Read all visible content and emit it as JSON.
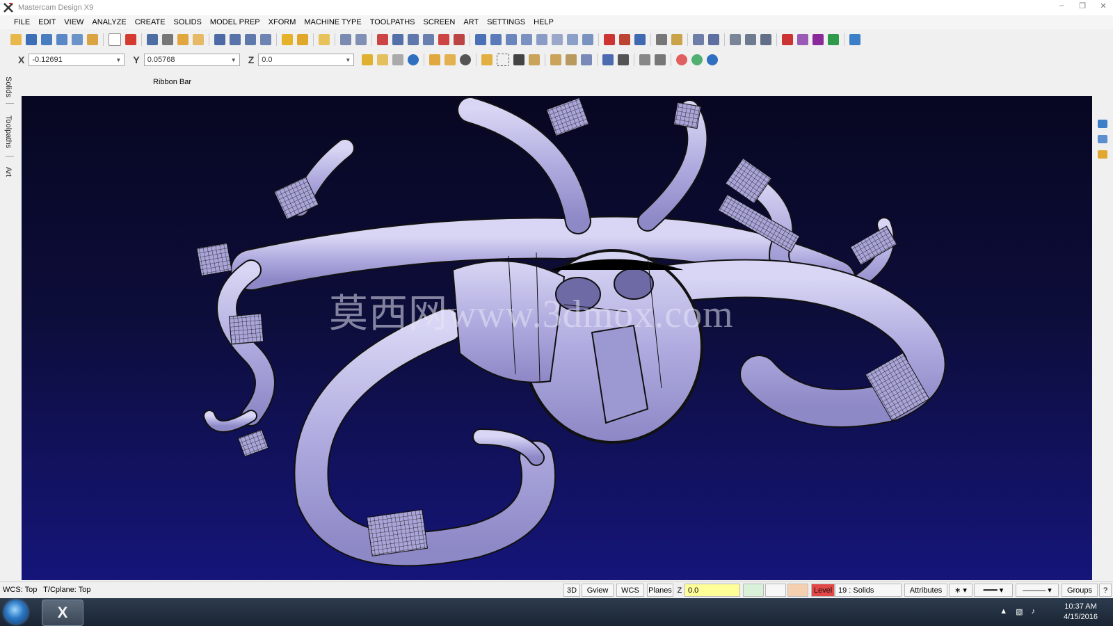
{
  "window": {
    "title": "Mastercam Design X9"
  },
  "menu": [
    "FILE",
    "EDIT",
    "VIEW",
    "ANALYZE",
    "CREATE",
    "SOLIDS",
    "MODEL PREP",
    "XFORM",
    "MACHINE TYPE",
    "TOOLPATHS",
    "SCREEN",
    "ART",
    "SETTINGS",
    "HELP"
  ],
  "coords": {
    "x_label": "X",
    "x_value": "-0.12691",
    "y_label": "Y",
    "y_value": "0.05768",
    "z_label": "Z",
    "z_value": "0.0"
  },
  "ribbon_label": "Ribbon Bar",
  "left_tabs": [
    "Solids",
    "Toolpaths",
    "Art"
  ],
  "viewport": {
    "watermark": "莫西网www.3dmox.com"
  },
  "status": {
    "wcs": "WCS: Top",
    "tcplane": "T/Cplane: Top",
    "btn_3d": "3D",
    "btn_gview": "Gview",
    "btn_wcs": "WCS",
    "btn_planes": "Planes",
    "z_label": "Z",
    "z_value": "0.0",
    "level_label": "Level",
    "level_value": "19 : Solids",
    "attributes": "Attributes",
    "groups": "Groups",
    "help": "?"
  },
  "taskbar": {
    "time": "10:37 AM",
    "date": "4/15/2016"
  },
  "colors": {
    "viewport_top": "#070722",
    "viewport_bottom": "#15157a",
    "model": "#b7b4e6",
    "z_field": "#ffff99",
    "level_tag": "#e34848"
  }
}
